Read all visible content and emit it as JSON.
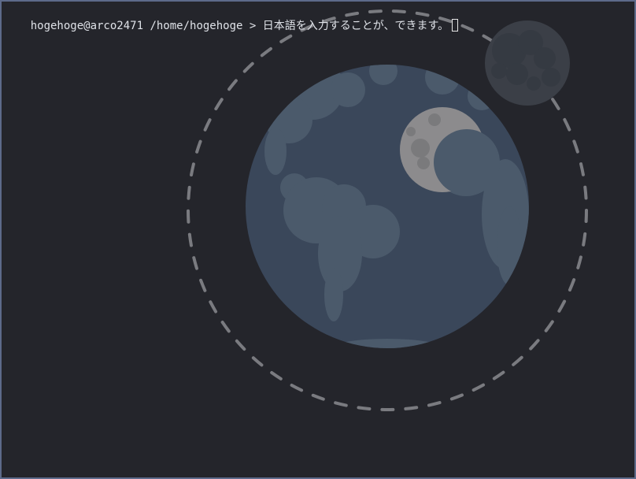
{
  "terminal": {
    "user_host": "hogehoge@arco2471",
    "cwd": "/home/hogehoge",
    "prompt_symbol": ">",
    "input_text": "日本語を入力することが、できます。"
  },
  "wallpaper": {
    "subject": "earth-and-moon",
    "colors": {
      "background": "#24252b",
      "ocean": "#3a475a",
      "land": "#4b5a6b",
      "orbit": "#7a7b80",
      "moon_dark": "#3b3f47",
      "moon_light": "#8c8b8d"
    }
  }
}
